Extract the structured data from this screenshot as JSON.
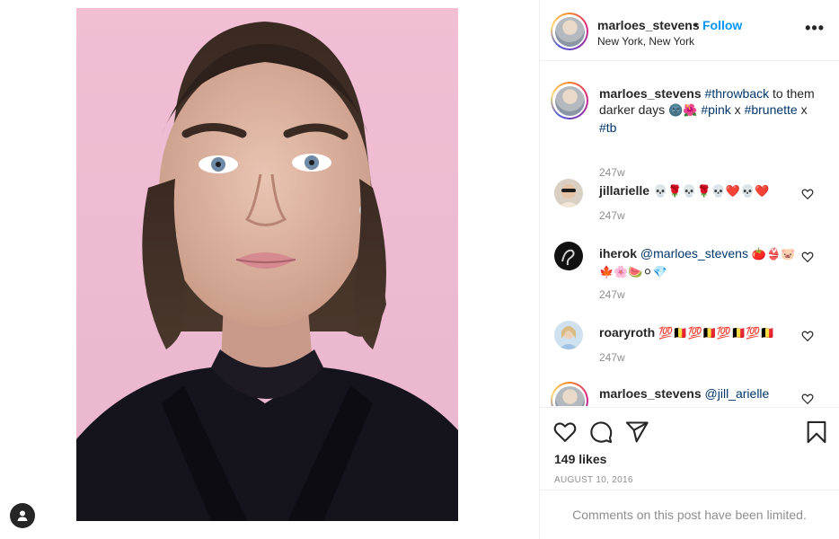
{
  "post": {
    "header": {
      "username": "marloes_stevens",
      "separator": "•",
      "follow_label": "Follow",
      "location": "New York, New York",
      "more_icon": "more-horizontal-icon"
    },
    "caption": {
      "username": "marloes_stevens",
      "hashtag1": "#throwback",
      "text1": " to them darker days ",
      "emoji1": "🌚🌺",
      "hashtag2": "#pink",
      "x1": " x ",
      "hashtag3": "#brunette",
      "x2": " x ",
      "hashtag4": "#tb",
      "time": "247w"
    },
    "comments": [
      {
        "username": "jillarielle",
        "mention": "",
        "text": "💀🌹💀🌹💀❤️💀❤️",
        "time": "247w"
      },
      {
        "username": "iherok",
        "mention": "@marloes_stevens",
        "text": "🍅👙🐷🍁🌸🍉⚪💎",
        "time": "247w"
      },
      {
        "username": "roaryroth",
        "mention": "",
        "text": "💯🇧🇪💯🇧🇪💯🇧🇪💯🇧🇪",
        "time": "247w"
      },
      {
        "username": "marloes_stevens",
        "mention": "@jill_arielle",
        "text": "",
        "time": ""
      }
    ],
    "likes": "149 likes",
    "date": "AUGUST 10, 2016",
    "limited_notice": "Comments on this post have been limited."
  },
  "colors": {
    "accent": "#0095f6",
    "hashtag": "#00376b",
    "muted": "#8e8e8e",
    "photo_background": "#efbbd3"
  }
}
